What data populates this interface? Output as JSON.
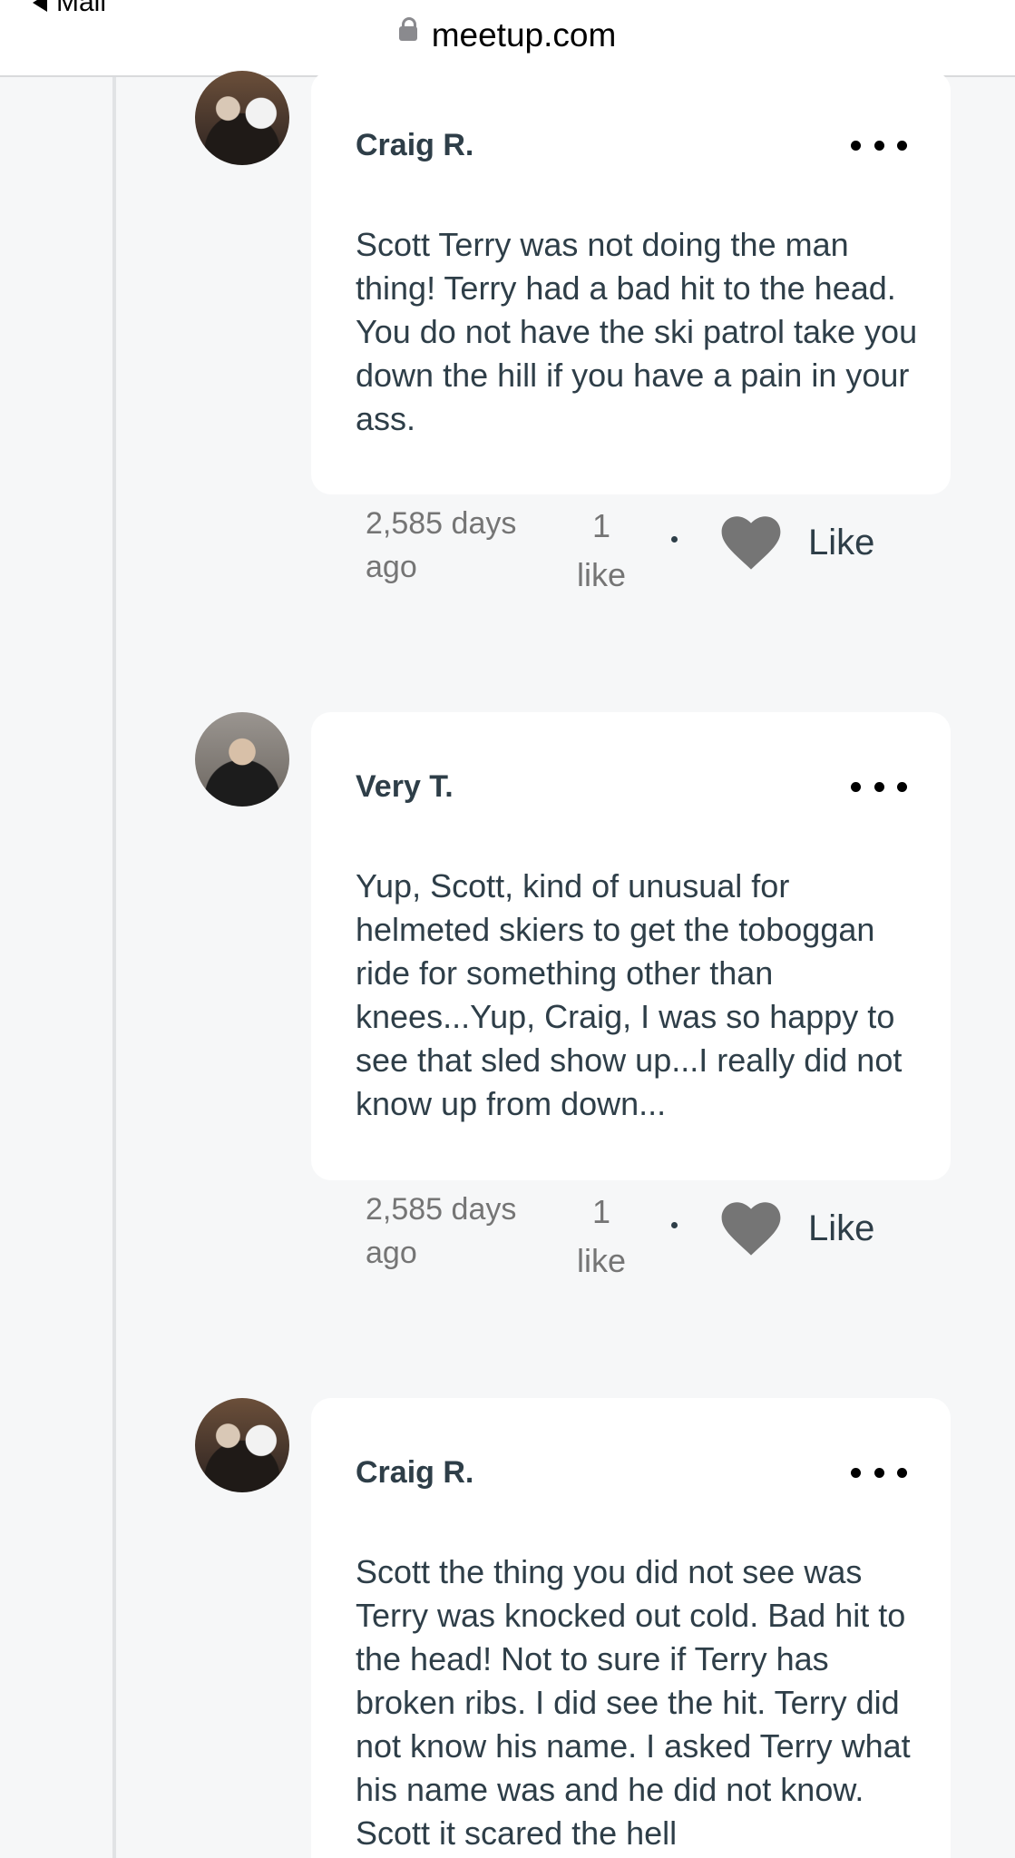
{
  "browser": {
    "back_label": "Mail",
    "url": "meetup.com"
  },
  "comments": [
    {
      "author": "Craig R.",
      "text": "Scott Terry was not doing the man thing! Terry had a bad hit to the head. You do not have the ski patrol take you down the hill if you have a pain in your ass.",
      "timestamp": "2,585 days ago",
      "likes": "1 like",
      "like_label": "Like"
    },
    {
      "author": "Very T.",
      "text": "Yup, Scott, kind of unusual for helmeted skiers to get the toboggan ride for something other than knees...Yup, Craig, I was so happy to see that sled show up...I really did not know up from down...",
      "timestamp": "2,585 days ago",
      "likes": "1 like",
      "like_label": "Like"
    },
    {
      "author": "Craig R.",
      "text": "Scott the thing you did not see was Terry was knocked out cold. Bad hit to the head! Not to sure if Terry has broken ribs. I did see the hit. Terry did not know his name. I asked Terry what his name was and he did not know. Scott it scared the hell"
    }
  ],
  "icons": {
    "more": "more-dots-icon",
    "heart": "heart-icon",
    "lock": "lock-icon",
    "back": "back-triangle-icon"
  },
  "colors": {
    "background": "#f6f7f8",
    "card": "#ffffff",
    "text": "#2e3e48",
    "muted": "#757575",
    "heart": "#757575"
  }
}
